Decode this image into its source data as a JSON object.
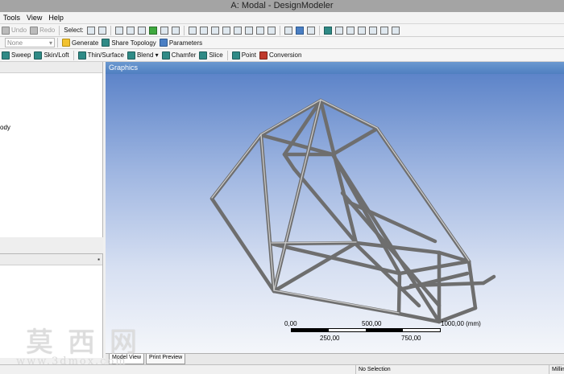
{
  "window": {
    "title": "A: Modal - DesignModeler"
  },
  "menu": {
    "items": [
      "Tools",
      "View",
      "Help"
    ]
  },
  "toolbar1": {
    "undo_label": "Undo",
    "redo_label": "Redo",
    "select_label": "Select:"
  },
  "toolbar2": {
    "plane_combo": "None",
    "generate_label": "Generate",
    "share_topology_label": "Share Topology",
    "parameters_label": "Parameters"
  },
  "toolbar3": {
    "sweep_label": "Sweep",
    "skinloft_label": "Skin/Loft",
    "thinsurface_label": "Thin/Surface",
    "blend_label": "Blend",
    "chamfer_label": "Chamfer",
    "slice_label": "Slice",
    "point_label": "Point",
    "conversion_label": "Conversion"
  },
  "tree": {
    "item_partial": "ody"
  },
  "graphics": {
    "header": "Graphics",
    "scale": {
      "top_labels": [
        "0,00",
        "500,00",
        "1000,00 (mm)"
      ],
      "bottom_labels": [
        "250,00",
        "750,00"
      ]
    }
  },
  "tabs": [
    {
      "label": "Model View",
      "active": true
    },
    {
      "label": "Print Preview",
      "active": false
    }
  ],
  "status": {
    "selection": "No Selection",
    "units": "Millim"
  },
  "watermark": {
    "chinese": "莫西网",
    "url": "www.3dmox.com"
  },
  "colors": {
    "graphics_top": "#5d84c9",
    "graphics_bottom": "#f4f6fa",
    "frame": "#9a9a9a"
  }
}
